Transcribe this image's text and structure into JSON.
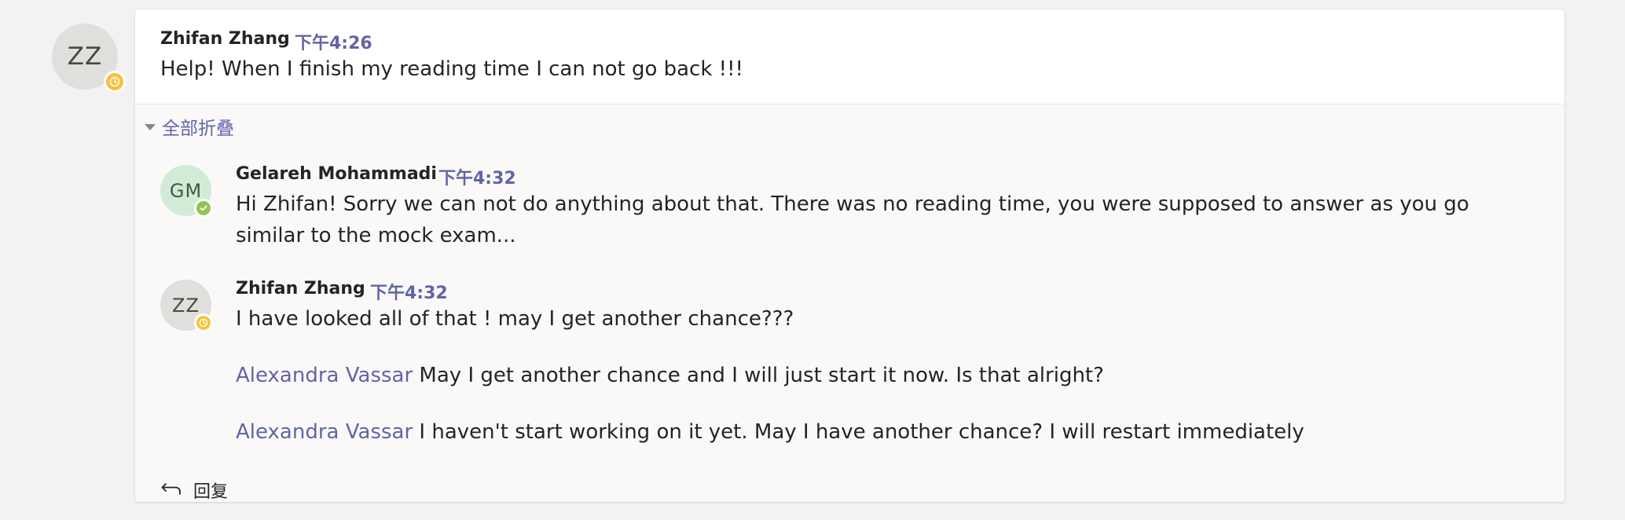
{
  "thread": {
    "author": {
      "initials": "ZZ",
      "name": "Zhifan Zhang",
      "status": "away",
      "status_color": "#f8c13a"
    },
    "time": "下午4:26",
    "message": "Help! When I finish my reading time I can not go back !!!",
    "collapse_label": "全部折叠",
    "reply_label": "回复"
  },
  "replies": [
    {
      "initials": "GM",
      "name": "Gelareh Mohammadi",
      "time": "下午4:32",
      "status": "available",
      "status_color": "#92c353",
      "message": "Hi Zhifan! Sorry we can not do anything about that. There was no reading time, you were supposed to answer as you go similar to the mock exam..."
    },
    {
      "initials": "ZZ",
      "name": "Zhifan Zhang",
      "time": "下午4:32",
      "status": "away",
      "status_color": "#f8c13a",
      "message": "I have looked all of that ! may I get another chance???",
      "followups": [
        {
          "mention": "Alexandra Vassar",
          "text": " May I get another chance and I will just start it now. Is that alright?"
        },
        {
          "mention": "Alexandra Vassar",
          "text": " I haven't start  working on it yet. May I have another chance? I will restart immediately"
        }
      ]
    }
  ],
  "colors": {
    "accent": "#6264a7",
    "background": "#f3f2f1",
    "card": "#faf9f8",
    "card_top": "#ffffff"
  }
}
